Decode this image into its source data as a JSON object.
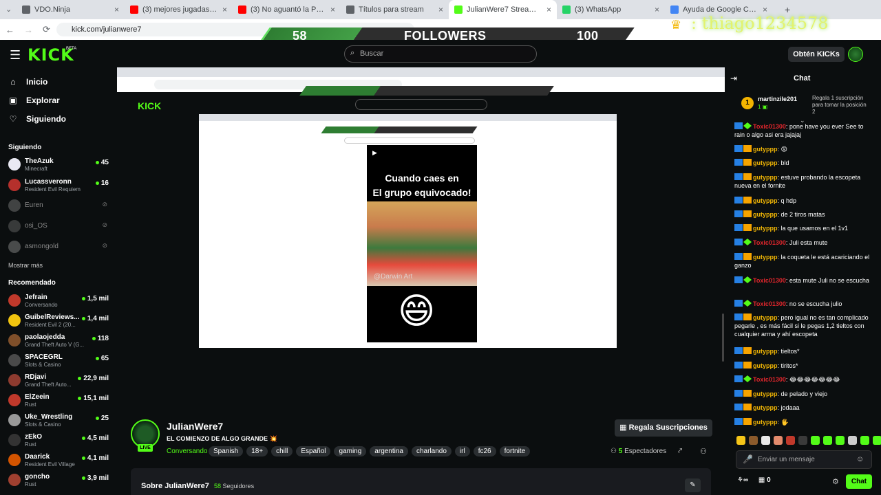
{
  "browser": {
    "tabs": [
      {
        "label": "VDO.Ninja",
        "color": "#5f6368"
      },
      {
        "label": "(3) mejores jugadas de messi -",
        "color": "#ff0000"
      },
      {
        "label": "(3) No aguantó la Presión",
        "color": "#ff0000"
      },
      {
        "label": "Títulos para stream",
        "color": "#5f6368"
      },
      {
        "label": "JulianWere7 Stream - Watch Li",
        "color": "#53fc18"
      },
      {
        "label": "(3) WhatsApp",
        "color": "#25d366"
      },
      {
        "label": "Ayuda de Google Chrome",
        "color": "#4285f4"
      }
    ],
    "url": "kick.com/julianwere7",
    "new_tab": "+"
  },
  "overlay": {
    "count_left": "58",
    "label": "FOLLOWERS",
    "count_right": "100",
    "username": ": thiago1234578"
  },
  "header": {
    "logo": "KICK",
    "beta": "BETA",
    "search_placeholder": "Buscar",
    "kicks_button": "Obtén KICKs"
  },
  "sidebar": {
    "nav": [
      {
        "label": "Inicio",
        "icon": "home-icon"
      },
      {
        "label": "Explorar",
        "icon": "compass-icon"
      },
      {
        "label": "Siguiendo",
        "icon": "heart-icon"
      }
    ],
    "following_header": "Siguiendo",
    "following": [
      {
        "name": "TheAzuk",
        "category": "Minecraft",
        "viewers": "45",
        "color": "#e9e9f3"
      },
      {
        "name": "Lucassveronn",
        "category": "Resident Evil Requiem",
        "viewers": "16",
        "color": "#b5302c"
      },
      {
        "name": "Euren",
        "category": "",
        "viewers": "",
        "color": "#777"
      },
      {
        "name": "osi_OS",
        "category": "",
        "viewers": "",
        "color": "#666"
      },
      {
        "name": "asmongold",
        "category": "",
        "viewers": "",
        "color": "#888"
      }
    ],
    "more_label": "Mostrar más",
    "recommended_header": "Recomendado",
    "recommended": [
      {
        "name": "Jefrain",
        "category": "Conversando",
        "viewers": "1,5 mil",
        "color": "#c0392b"
      },
      {
        "name": "GuibelReviews...",
        "category": "Resident Evil 2 (20...",
        "viewers": "1,4 mil",
        "color": "#f1c40f"
      },
      {
        "name": "paolaojedda",
        "category": "Grand Theft Auto V (G...",
        "viewers": "118",
        "color": "#7f4f2a"
      },
      {
        "name": "SPACEGRL",
        "category": "Slots & Casino",
        "viewers": "65",
        "color": "#4a4a4a"
      },
      {
        "name": "RDjavi",
        "category": "Grand Theft Auto...",
        "viewers": "22,9 mil",
        "color": "#8e3b2f"
      },
      {
        "name": "ElZeein",
        "category": "Rust",
        "viewers": "15,1 mil",
        "color": "#c0392b"
      },
      {
        "name": "Uke_Wrestling",
        "category": "Slots & Casino",
        "viewers": "25",
        "color": "#999"
      },
      {
        "name": "zEkO",
        "category": "Rust",
        "viewers": "4,5 mil",
        "color": "#333"
      },
      {
        "name": "Daarick",
        "category": "Resident Evil Village",
        "viewers": "4,1 mil",
        "color": "#d35400"
      },
      {
        "name": "goncho",
        "category": "Rust",
        "viewers": "3,9 mil",
        "color": "#a04030"
      }
    ]
  },
  "stream": {
    "streamer": "JulianWere7",
    "live": "LIVE",
    "title": "EL COMIENZO DE ALGO GRANDE 💥",
    "category": "Conversando",
    "tags": [
      "Spanish",
      "18+",
      "chill",
      "Español",
      "gaming",
      "argentina",
      "charlando",
      "irl",
      "fc26",
      "fortnite"
    ],
    "gift_button": "Regala Suscripciones",
    "viewers_count": "5",
    "viewers_label": "Espectadores",
    "about_title": "Sobre JulianWere7",
    "followers_count": "58",
    "followers_label": "Seguidores"
  },
  "video": {
    "meme_line1": "Cuando caes en",
    "meme_line2": "El grupo equivocado!",
    "watermark": "@Darwin Art",
    "emoji": "😄"
  },
  "chat": {
    "title": "Chat",
    "pinned_user": "martinzile201",
    "pinned_badge": "1",
    "pinned_text": "Regala 1 suscripción para tomar la posición 2",
    "messages": [
      {
        "user": "Toxic01300",
        "kind": "red",
        "text": ": pone have you ever See to rain o algo asi era jajajaj"
      },
      {
        "user": "gutyppp",
        "kind": "yel",
        "text": ": 😡"
      },
      {
        "user": "gutyppp",
        "kind": "yel",
        "text": ": bld"
      },
      {
        "user": "gutyppp",
        "kind": "yel",
        "text": ": estuve probando la escopeta nueva en el fornite"
      },
      {
        "user": "gutyppp",
        "kind": "yel",
        "text": ": q hdp"
      },
      {
        "user": "gutyppp",
        "kind": "yel",
        "text": ": de 2 tiros matas"
      },
      {
        "user": "gutyppp",
        "kind": "yel",
        "text": ": la que usamos en el 1v1"
      },
      {
        "user": "Toxic01300",
        "kind": "red",
        "text": ": Juli esta mute"
      },
      {
        "user": "gutyppp",
        "kind": "yel",
        "text": ": la coqueta le está acariciando el ganzo"
      },
      {
        "user": "Toxic01300",
        "kind": "red",
        "text": ": esta mute Juli no se escucha"
      },
      {
        "user": "Toxic01300",
        "kind": "red",
        "text": ": no se escucha julio"
      },
      {
        "user": "gutyppp",
        "kind": "yel",
        "text": ": pero igual no es tan complicado pegarle , es más fácil si le pegas 1,2 tieltos con cualquier arma y ahí escopeta"
      },
      {
        "user": "gutyppp",
        "kind": "yel",
        "text": ": tieltos*"
      },
      {
        "user": "gutyppp",
        "kind": "yel",
        "text": ": tiritos*"
      },
      {
        "user": "Toxic01300",
        "kind": "red",
        "text": ": 😂😂😂😂😂😂😂"
      },
      {
        "user": "gutyppp",
        "kind": "yel",
        "text": ": de pelado y viejo"
      },
      {
        "user": "gutyppp",
        "kind": "yel",
        "text": ": jodaaa"
      },
      {
        "user": "gutyppp",
        "kind": "yel",
        "text": ": 🖐"
      }
    ],
    "input_placeholder": "Enviar un mensaje",
    "kicks_count": "0",
    "send_button": "Chat"
  }
}
